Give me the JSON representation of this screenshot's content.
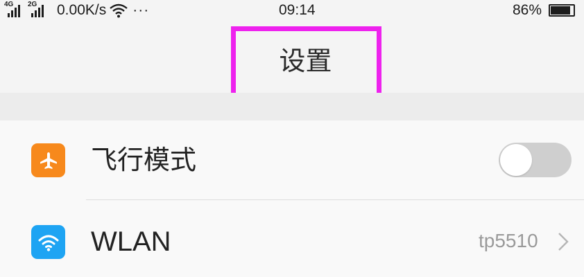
{
  "status_bar": {
    "network_1": "4G",
    "network_2": "2G",
    "speed": "0.00K/s",
    "more": "···",
    "time": "09:14",
    "battery": "86%",
    "battery_level": 0.86,
    "icons": [
      "signal-icon",
      "signal-icon",
      "wifi-icon",
      "battery-icon"
    ]
  },
  "header": {
    "title": "设置",
    "highlight_color": "#ee22ee"
  },
  "settings": {
    "items": [
      {
        "label": "飞行模式",
        "icon": "airplane-icon",
        "icon_color": "#f7891c",
        "toggle_on": false
      },
      {
        "label": "WLAN",
        "icon": "wifi-icon",
        "icon_color": "#1ea4f3",
        "value": "tp5510",
        "chevron": "chevron-right-icon"
      }
    ]
  }
}
